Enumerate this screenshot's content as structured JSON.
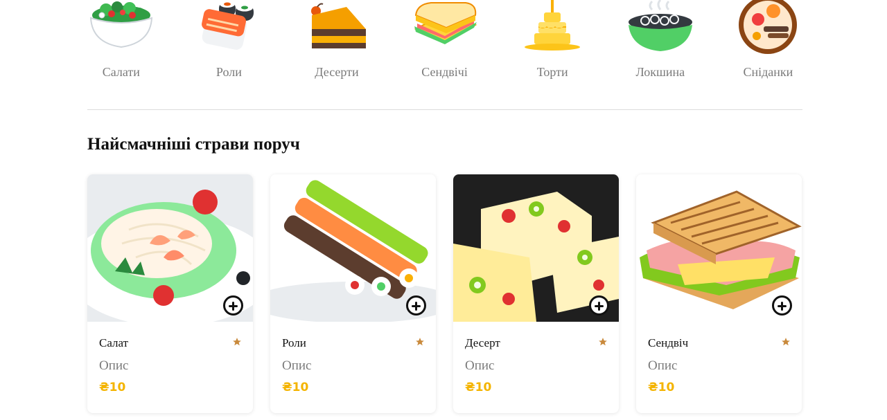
{
  "categories": [
    {
      "label": "Салати",
      "icon": "salad-icon"
    },
    {
      "label": "Роли",
      "icon": "sushi-rolls-icon"
    },
    {
      "label": "Десерти",
      "icon": "cake-slice-icon"
    },
    {
      "label": "Сендвічі",
      "icon": "sandwich-icon"
    },
    {
      "label": "Торти",
      "icon": "tiered-cake-icon"
    },
    {
      "label": "Локшина",
      "icon": "noodle-bowl-icon"
    },
    {
      "label": "Сніданки",
      "icon": "breakfast-plate-icon"
    }
  ],
  "section": {
    "title": "Найсмачніші страви поруч"
  },
  "products": [
    {
      "name": "Салат",
      "description": "Опис",
      "price": "₴10",
      "image": "caesar-salad-photo"
    },
    {
      "name": "Роли",
      "description": "Опис",
      "price": "₴10",
      "image": "sushi-rolls-photo"
    },
    {
      "name": "Десерт",
      "description": "Опис",
      "price": "₴10",
      "image": "fruit-jelly-dessert-photo"
    },
    {
      "name": "Сендвіч",
      "description": "Опис",
      "price": "₴10",
      "image": "ham-sandwich-photo"
    }
  ],
  "colors": {
    "price": "#f4b400",
    "star": "#c98a3c",
    "muted_text": "#7a7a7a",
    "divider": "#dcdcdc"
  }
}
